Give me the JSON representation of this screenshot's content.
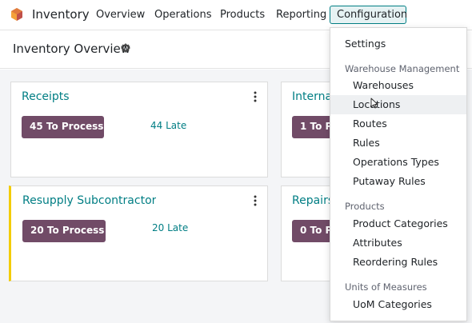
{
  "app": {
    "name": "Inventory"
  },
  "nav": {
    "items": [
      "Overview",
      "Operations",
      "Products",
      "Reporting"
    ],
    "active": "Configuration"
  },
  "page": {
    "title": "Inventory Overview"
  },
  "cards": [
    {
      "title": "Receipts",
      "process": "45 To Process",
      "late": "44 Late"
    },
    {
      "title": "Interna",
      "process": "1 To Pr"
    },
    {
      "title": "Resupply Subcontractor",
      "process": "20 To Process",
      "late": "20 Late"
    },
    {
      "title": "Repairs",
      "process": "0 To Pr"
    }
  ],
  "dropdown": {
    "settings": "Settings",
    "sections": [
      {
        "header": "Warehouse Management",
        "items": [
          "Warehouses",
          "Locations",
          "Routes",
          "Rules",
          "Operations Types",
          "Putaway Rules"
        ]
      },
      {
        "header": "Products",
        "items": [
          "Product Categories",
          "Attributes",
          "Reordering Rules"
        ]
      },
      {
        "header": "Units of Measures",
        "items": [
          "UoM Categories"
        ]
      }
    ],
    "hovered": "Locations"
  },
  "colors": {
    "brand": "#714b67",
    "accent": "#017e84",
    "warning": "#f3cc00"
  },
  "icons": {
    "logo": "inventory-logo-icon",
    "gear": "gear-icon",
    "kebab": "kebab-menu-icon",
    "cursor": "mouse-pointer-icon"
  }
}
